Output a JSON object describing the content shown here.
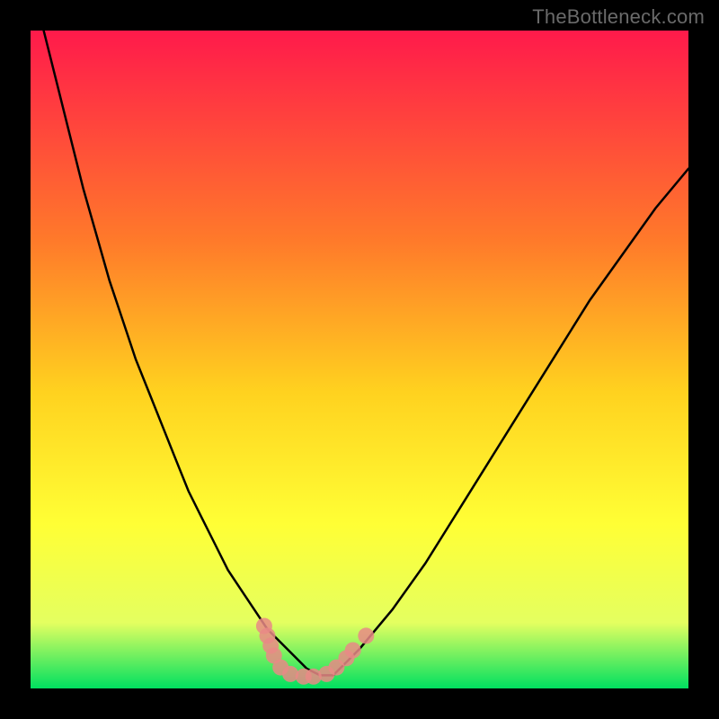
{
  "watermark": "TheBottleneck.com",
  "colors": {
    "frame": "#000000",
    "gradient_top": "#ff1a4b",
    "gradient_mid1": "#ff7a2a",
    "gradient_mid2": "#ffd21f",
    "gradient_mid3": "#ffff35",
    "gradient_mid4": "#e4ff60",
    "gradient_bottom": "#00e060",
    "curve": "#000000",
    "marker_ring": "#e98a86",
    "marker_fill": "#e98a86"
  },
  "chart_data": {
    "type": "line",
    "title": "",
    "xlabel": "",
    "ylabel": "",
    "xlim": [
      0,
      100
    ],
    "ylim": [
      0,
      100
    ],
    "series": [
      {
        "name": "bottleneck-curve",
        "x": [
          2,
          4,
          6,
          8,
          10,
          12,
          14,
          16,
          18,
          20,
          22,
          24,
          26,
          28,
          30,
          32,
          34,
          36,
          38,
          40,
          42,
          44,
          46,
          48,
          50,
          55,
          60,
          65,
          70,
          75,
          80,
          85,
          90,
          95,
          100
        ],
        "y": [
          100,
          92,
          84,
          76,
          69,
          62,
          56,
          50,
          45,
          40,
          35,
          30,
          26,
          22,
          18,
          15,
          12,
          9,
          7,
          5,
          3,
          2,
          2,
          4,
          6,
          12,
          19,
          27,
          35,
          43,
          51,
          59,
          66,
          73,
          79
        ]
      }
    ],
    "markers": [
      {
        "name": "pt-a",
        "x": 35.5,
        "y": 9.5
      },
      {
        "name": "pt-b",
        "x": 36.0,
        "y": 8.0
      },
      {
        "name": "pt-c",
        "x": 36.5,
        "y": 6.5
      },
      {
        "name": "pt-d",
        "x": 37.0,
        "y": 5.0
      },
      {
        "name": "pt-e",
        "x": 38.0,
        "y": 3.2
      },
      {
        "name": "pt-f",
        "x": 39.5,
        "y": 2.2
      },
      {
        "name": "pt-g",
        "x": 41.5,
        "y": 1.8
      },
      {
        "name": "pt-h",
        "x": 43.0,
        "y": 1.8
      },
      {
        "name": "pt-i",
        "x": 45.0,
        "y": 2.2
      },
      {
        "name": "pt-j",
        "x": 46.5,
        "y": 3.2
      },
      {
        "name": "pt-k",
        "x": 48.0,
        "y": 4.6
      },
      {
        "name": "pt-l",
        "x": 49.0,
        "y": 5.8
      },
      {
        "name": "pt-m",
        "x": 51.0,
        "y": 8.0
      }
    ]
  }
}
